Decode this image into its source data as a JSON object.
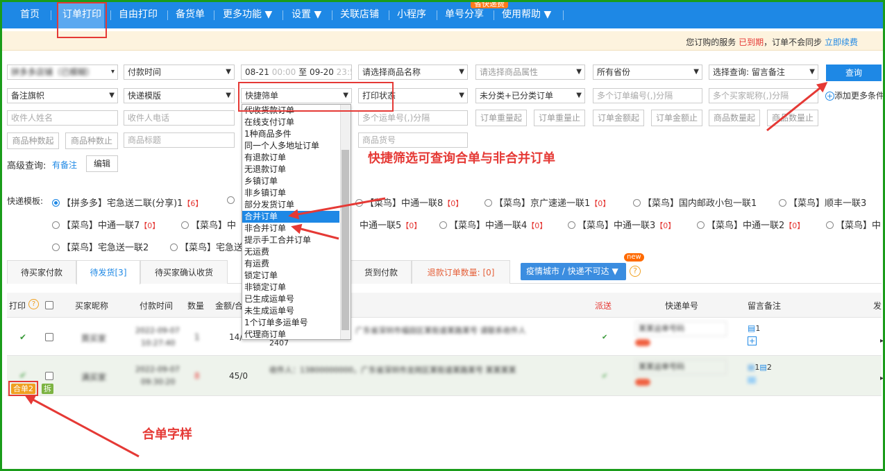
{
  "nav": {
    "items": [
      "首页",
      "订单打印",
      "自由打印",
      "备货单",
      "更多功能 ▼",
      "设置 ▼",
      "关联店铺",
      "小程序",
      "单号分享",
      "使用帮助 ▼"
    ],
    "hot_badge": "省快递费"
  },
  "notice": {
    "prefix": "您订购的服务",
    "status": "已到期",
    "middle": "，订单不会同步",
    "renew": "立即续费"
  },
  "filters": {
    "shop": "拼多多店铺（已模糊）",
    "time_type": "付款时间",
    "date_from": "08-21",
    "time_from": "00:00",
    "date_sep": "至",
    "date_to": "09-20",
    "time_to": "23:59",
    "product_name": "请选择商品名称",
    "product_attr": "请选择商品属性",
    "province": "所有省份",
    "select_query": "选择查询: 留言备注",
    "query_btn": "查询",
    "remark_flag": "备注旗帜",
    "express_tpl": "快递模版",
    "quick_filter": "快捷筛单",
    "print_status": "打印状态",
    "category": "未分类+已分类订单",
    "order_nos_ph": "多个订单编号(,)分隔",
    "buyer_nick_ph": "多个买家昵称(,)分隔",
    "add_more": "添加更多条件",
    "receiver_name_ph": "收件人姓名",
    "receiver_phone_ph": "收件人电话",
    "waybill_ph": "多个运单号(,)分隔",
    "weight_from_ph": "订单重量起",
    "weight_to_ph": "订单重量止",
    "amount_from_ph": "订单金额起",
    "amount_to_ph": "订单金额止",
    "qty_from_ph": "商品数量起",
    "qty_to_ph": "商品数量止",
    "kind_from_ph": "商品种数起",
    "kind_to_ph": "商品种数止",
    "title_ph": "商品标题",
    "sku_ph": "商品货号",
    "advanced_label": "高级查询:",
    "advanced_value": "有备注",
    "edit_btn": "编辑"
  },
  "dropdown": {
    "options": [
      "代收货款订单",
      "在线支付订单",
      "1种商品多件",
      "同一个人多地址订单",
      "有退款订单",
      "无退款订单",
      "乡镇订单",
      "非乡镇订单",
      "部分发货订单",
      "合并订单",
      "非合并订单",
      "提示手工合并订单",
      "无运费",
      "有运费",
      "锁定订单",
      "非锁定订单",
      "已生成运单号",
      "未生成运单号",
      "1个订单多运单号",
      "代理商订单"
    ],
    "selected_index": 9
  },
  "annotations": {
    "quick_filter_note": "快捷筛选可查询合单与非合并订单",
    "merge_note": "合单字样"
  },
  "templates": {
    "label": "快递模板:",
    "row1": [
      {
        "name": "【拼多多】宅急送二联(分享)1",
        "count": "【6】",
        "checked": true
      },
      {
        "name": "【菜鸟】中通一联8",
        "count": "【0】"
      },
      {
        "name": "【菜鸟】京广速递一联1",
        "count": "【0】"
      },
      {
        "name": "【菜鸟】国内邮政小包一联1",
        "count": ""
      },
      {
        "name": "【菜鸟】顺丰一联3",
        "count": ""
      }
    ],
    "row2": [
      {
        "name": "【菜鸟】中通一联7",
        "count": "【0】"
      },
      {
        "name": "【菜鸟】中",
        "count": ""
      },
      {
        "name": "中通一联5",
        "count": "【0】"
      },
      {
        "name": "【菜鸟】中通一联4",
        "count": "【0】"
      },
      {
        "name": "【菜鸟】中通一联3",
        "count": "【0】"
      },
      {
        "name": "【菜鸟】中通一联2",
        "count": "【0】"
      },
      {
        "name": "【菜鸟】中",
        "count": ""
      }
    ],
    "row3": [
      {
        "name": "【菜鸟】宅急送一联2",
        "count": ""
      },
      {
        "name": "【菜鸟】宅急送",
        "count": ""
      }
    ]
  },
  "tabs": {
    "items": [
      "待买家付款",
      "待发货[3]",
      "待买家确认收货"
    ],
    "cod": "货到付款",
    "refund_label": "退款订单数量:",
    "refund_count": "[0]",
    "epidemic": "疫情城市 / 快递不可达 ▼",
    "new_badge": "new",
    "help": "?"
  },
  "table": {
    "headers": {
      "print": "打印",
      "buyer": "买家昵称",
      "pay_time": "付款时间",
      "qty": "数量",
      "amount": "金额/合",
      "dispatch": "派送",
      "waybill": "快递单号",
      "remark": "留言备注",
      "more": "发"
    },
    "rows": [
      {
        "buyer": "買买家",
        "time_a": "2022-09-07",
        "time_b": "10:27:40",
        "qty": "1",
        "amount": "14/",
        "order_tail": "2407",
        "address": "广东省深圳市福田区某街道某路某号 请联系收件人",
        "waybill": "某某运单号码",
        "remark_count": "1"
      },
      {
        "buyer": "满买家",
        "time_a": "2022-09-07",
        "time_b": "09:30:20",
        "qty": "8",
        "amount": "45/0",
        "address": "收件人：13800000000，广东省深圳市龙岗区某街道某路某号 某某某某",
        "waybill": "某某运单号码",
        "remark_count": "2",
        "merge_tag": "合单2",
        "split_tag": "拆",
        "remark_a": "1"
      }
    ]
  }
}
